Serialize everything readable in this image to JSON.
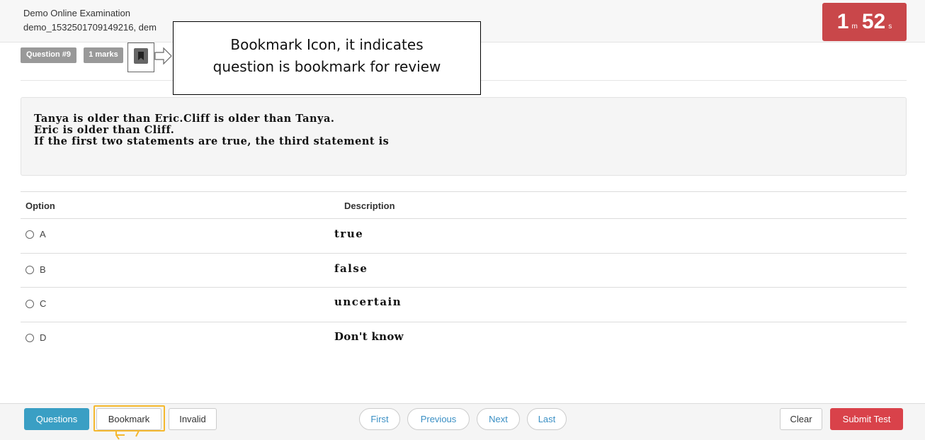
{
  "header": {
    "exam_title": "Demo Online Examination",
    "exam_subtitle": "demo_1532501709149216, dem",
    "timer": {
      "minutes": "1",
      "minutes_unit": "m",
      "seconds": "52",
      "seconds_unit": "s"
    }
  },
  "question_meta": {
    "number_badge": "Question #9",
    "marks_badge": "1 marks",
    "bookmark_icon": "bookmark-icon"
  },
  "callout": {
    "line1": "Bookmark Icon, it indicates",
    "line2": "question is bookmark for review"
  },
  "question": {
    "line1": "Tanya is older than Eric.Cliff is older than Tanya.",
    "line2": "Eric is older than Cliff.",
    "line3": "If the first two statements are true, the third statement is"
  },
  "table": {
    "headers": {
      "option": "Option",
      "description": "Description"
    },
    "rows": [
      {
        "option": "A",
        "description": "true"
      },
      {
        "option": "B",
        "description": "false"
      },
      {
        "option": "C",
        "description": "uncertain"
      },
      {
        "option": "D",
        "description": "Don't know"
      }
    ]
  },
  "footer": {
    "questions": "Questions",
    "bookmark": "Bookmark",
    "invalid": "Invalid",
    "first": "First",
    "previous": "Previous",
    "next": "Next",
    "last": "Last",
    "clear": "Clear",
    "submit": "Submit Test"
  },
  "colors": {
    "timer_bg": "#c9474a",
    "questions_btn": "#3a9fc4",
    "submit_btn": "#d9424a",
    "highlight": "#f5b82e"
  }
}
